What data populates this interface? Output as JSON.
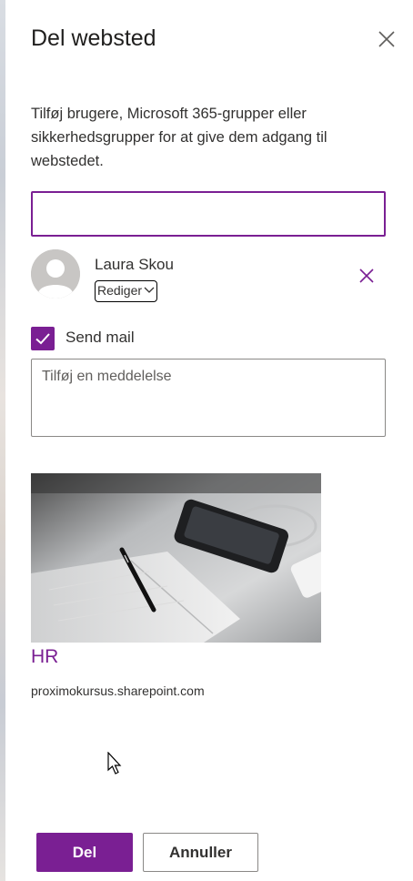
{
  "dialog": {
    "title": "Del websted",
    "description": "Tilføj brugere, Microsoft 365-grupper eller sikkerhedsgrupper for at give dem adgang til webstedet.",
    "people_input_value": ""
  },
  "user": {
    "name": "Laura Skou",
    "permission": "Rediger"
  },
  "send_mail": {
    "label": "Send mail",
    "checked": true
  },
  "message": {
    "placeholder": "Tilføj en meddelelse",
    "value": ""
  },
  "site": {
    "name": "HR",
    "url": "proximokursus.sharepoint.com"
  },
  "buttons": {
    "share": "Del",
    "cancel": "Annuller"
  },
  "colors": {
    "accent": "#7a1f93",
    "text": "#323130"
  },
  "icons": {
    "close": "close-icon",
    "remove": "close-icon",
    "chevron": "chevron-down-icon",
    "checkmark": "checkmark-icon",
    "avatar": "person-icon"
  }
}
